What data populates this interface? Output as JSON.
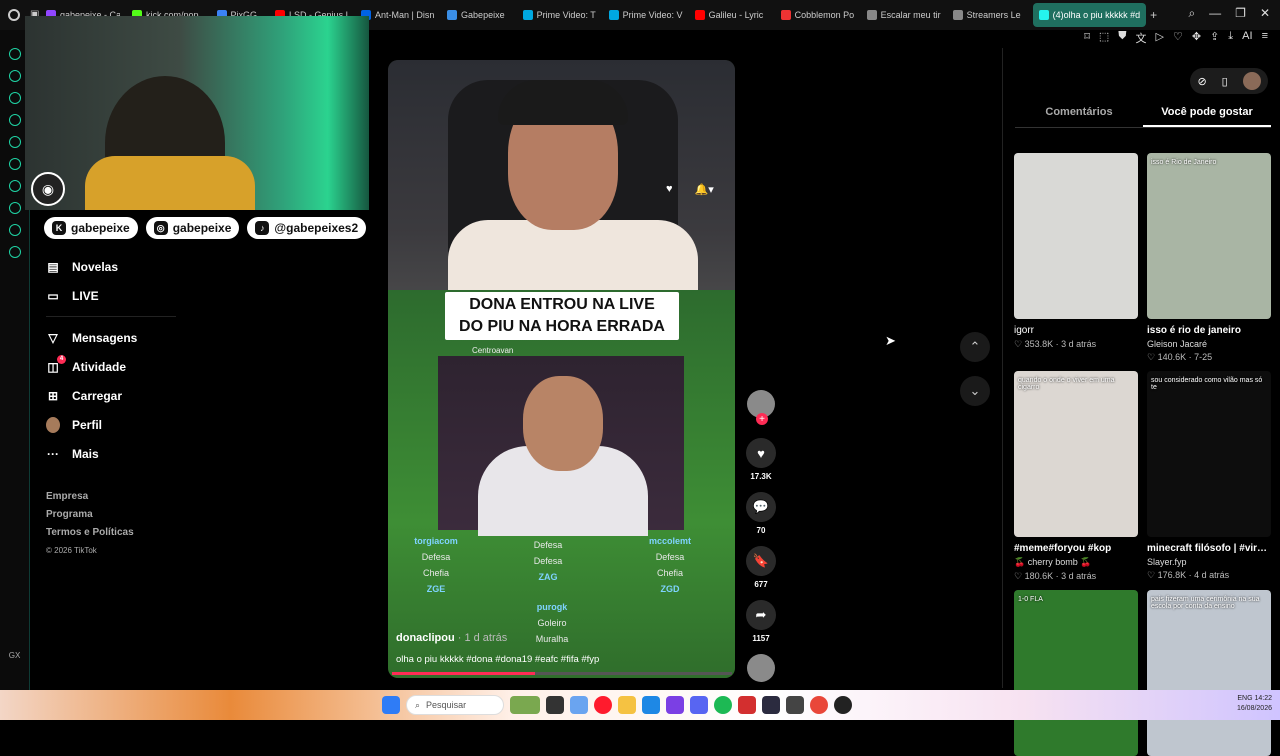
{
  "browser": {
    "tabs": [
      {
        "label": "gabepeixe - Ca",
        "color": "#9146ff"
      },
      {
        "label": "kick.com/pop",
        "color": "#53fc18"
      },
      {
        "label": "PixGG",
        "color": "#3b82f6"
      },
      {
        "label": "LSD - Genius L",
        "color": "#ff0000"
      },
      {
        "label": "Ant-Man | Disn",
        "color": "#0063e5"
      },
      {
        "label": "Gabepeixe",
        "color": "#3a8ee6"
      },
      {
        "label": "Prime Video: T",
        "color": "#00a8e1"
      },
      {
        "label": "Prime Video: V",
        "color": "#00a8e1"
      },
      {
        "label": "Galileu - Lyric",
        "color": "#ff0000"
      },
      {
        "label": "Cobblemon Po",
        "color": "#e33"
      },
      {
        "label": "Escalar meu tir",
        "color": "#888"
      },
      {
        "label": "Streamers Le",
        "color": "#888"
      },
      {
        "label": "(4)olha o piu kkkkk #d",
        "color": "#25f4ee",
        "active": true
      }
    ],
    "window_controls": [
      "search-icon",
      "minimize-icon",
      "maximize-icon",
      "close-icon"
    ]
  },
  "stream": {
    "socials": [
      {
        "icon": "kick-icon",
        "label": "gabepeixe"
      },
      {
        "icon": "instagram-icon",
        "label": "gabepeixe"
      },
      {
        "icon": "tiktok-icon",
        "label": "@gabepeixes2"
      }
    ]
  },
  "nav": {
    "items": [
      {
        "name": "novelas",
        "icon": "▤",
        "label": "Novelas"
      },
      {
        "name": "live",
        "icon": "▭",
        "label": "LIVE"
      },
      {
        "name": "mensagens",
        "icon": "▽",
        "label": "Mensagens"
      },
      {
        "name": "atividade",
        "icon": "◫",
        "label": "Atividade",
        "badge": "4"
      },
      {
        "name": "carregar",
        "icon": "⊞",
        "label": "Carregar"
      },
      {
        "name": "perfil",
        "icon": "",
        "label": "Perfil"
      },
      {
        "name": "mais",
        "icon": "···",
        "label": "Mais"
      }
    ],
    "footer": [
      "Empresa",
      "Programa",
      "Termos e Políticas"
    ],
    "copyright": "© 2026 TikTok"
  },
  "video": {
    "caption_line1": "DONA ENTROU NA LIVE",
    "caption_line2": "DO PIU NA HORA ERRADA",
    "username": "donaclipou",
    "date": "· 1 d atrás",
    "description": "olha o piu kkkkk #dona #dona19 #eafc #fifa #fyp",
    "progress": 0.42,
    "game": {
      "players": [
        {
          "name": "torgiacom",
          "role": "Defesa",
          "sub": "Chefia",
          "club": "ZGE"
        },
        {
          "name": "",
          "role": "Defesa",
          "sub": "Defesa",
          "club": "ZAG"
        },
        {
          "name": "mccolemt",
          "role": "Defesa",
          "sub": "Chefia",
          "club": "ZGD"
        },
        {
          "name": "purogk",
          "role": "Goleiro",
          "sub": "Muralha",
          "club": ""
        }
      ],
      "centro": "Centroavan"
    }
  },
  "actions": {
    "like": "17.3K",
    "comments": "70",
    "saves": "677",
    "shares": "1157"
  },
  "right_panel": {
    "tabs": [
      "Comentários",
      "Você pode gostar"
    ],
    "active_tab": 1,
    "cards": [
      {
        "title": "igorr",
        "author": "",
        "stats": "♡ 353.8K · 3 d atrás",
        "bold": false,
        "thumb": "#d9d9d6",
        "overlay": ""
      },
      {
        "title": "isso é rio de janeiro",
        "author": "Gleison Jacaré",
        "stats": "♡ 140.6K · 7-25",
        "bold": true,
        "thumb": "#a9b5a4",
        "overlay": "isso é Rio de Janeiro"
      },
      {
        "title": "#meme#foryou #kop",
        "author": "🍒 cherry bomb 🍒",
        "stats": "♡ 180.6K · 3 d atrás",
        "bold": true,
        "thumb": "#dcd7d2",
        "overlay": "quando o onde o viver em uma cigarro"
      },
      {
        "title": "minecraft filósofo | #viral #fyp #minecraf...",
        "author": "Slayer.fyp",
        "stats": "♡ 176.8K · 4 d atrás",
        "bold": true,
        "thumb": "#0d0d0d",
        "overlay": "sou considerado como vilão mas só te"
      },
      {
        "title": "",
        "author": "",
        "stats": "",
        "bold": true,
        "thumb": "#2f7a2c",
        "overlay": "1-0 FLA"
      },
      {
        "title": "",
        "author": "",
        "stats": "",
        "bold": true,
        "thumb": "#bfc6cf",
        "overlay": "pais fizeram uma cerimônia na sua escola por conta da ensino"
      }
    ]
  },
  "taskbar": {
    "search_placeholder": "Pesquisar",
    "lang": "ENG",
    "time": "14:22",
    "date": "16/08/2026"
  }
}
